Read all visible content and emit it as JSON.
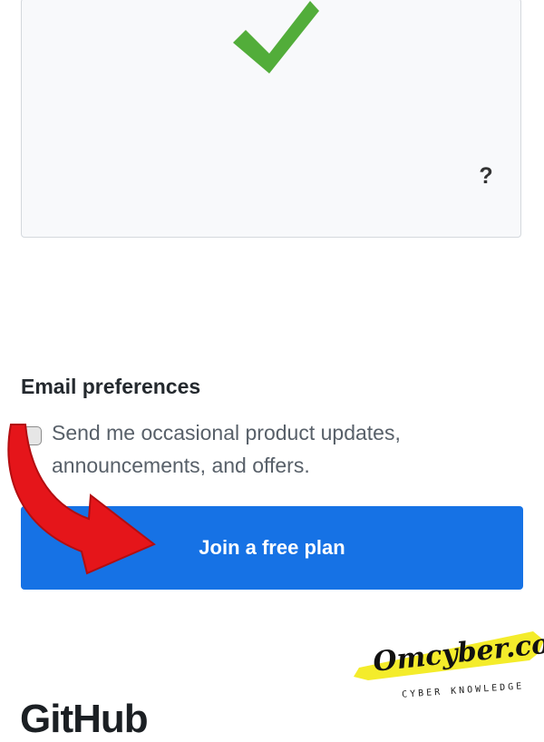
{
  "captcha": {
    "check_icon": "checkmark-icon",
    "help_label": "?",
    "colors": {
      "check": "#52ad3a"
    }
  },
  "email_preferences": {
    "title": "Email preferences",
    "checkbox_label": "Send me occasional product updates, announcements, and offers.",
    "checked": false
  },
  "cta": {
    "label": "Join a free plan",
    "color": "#1672e5"
  },
  "overlay": {
    "arrow_icon": "red-arrow-icon",
    "arrow_color": "#e5151a",
    "watermark_text": "Omcyber.com",
    "watermark_tagline": "CYBER KNOWLEDGE",
    "highlight_color": "#f4ec2b"
  },
  "footer": {
    "logo_text": "GitHub"
  }
}
